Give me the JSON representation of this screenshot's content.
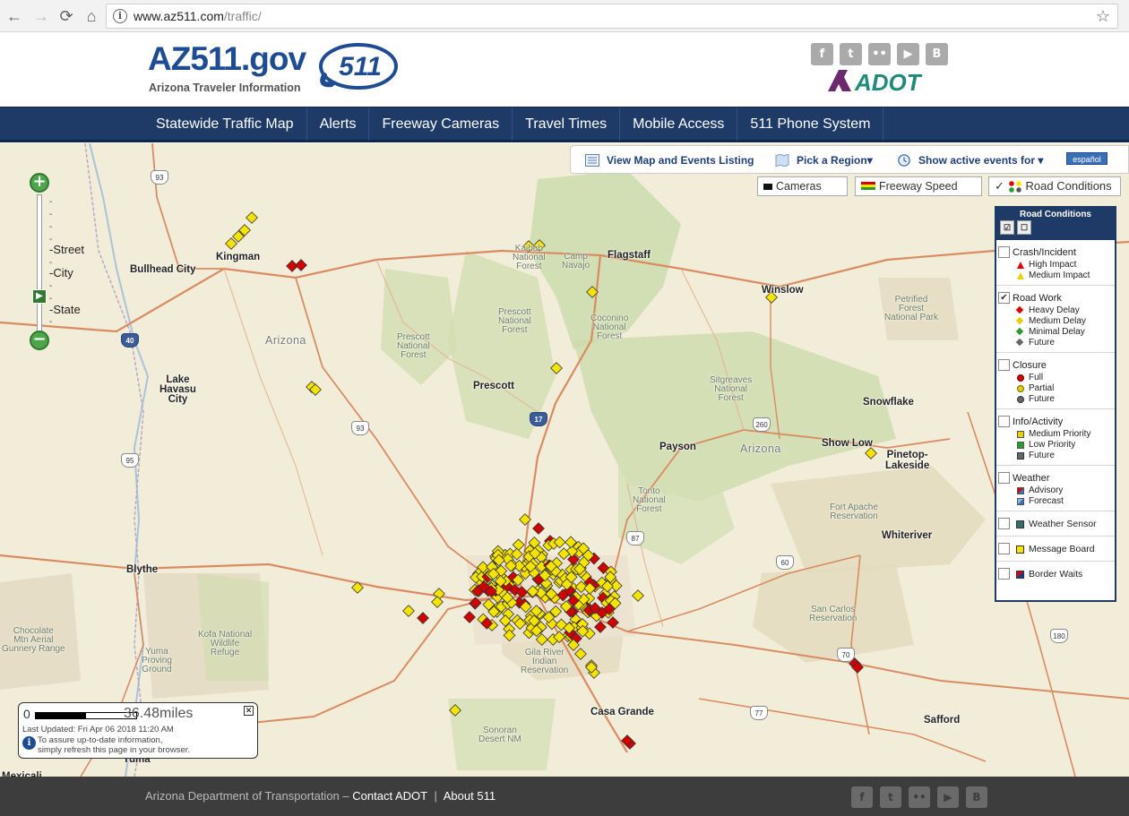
{
  "browser": {
    "url_host": "www.az511.com",
    "url_path": "/traffic/"
  },
  "header": {
    "logo_title": "AZ511.gov",
    "logo_badge": "511",
    "logo_subtitle": "Arizona Traveler Information",
    "agency_logo": "ADOT",
    "social_icons": [
      "facebook-icon",
      "twitter-icon",
      "flickr-icon",
      "youtube-icon",
      "blogger-icon"
    ]
  },
  "nav": {
    "items": [
      "Statewide Traffic Map",
      "Alerts",
      "Freeway Cameras",
      "Travel Times",
      "Mobile Access",
      "511 Phone System"
    ]
  },
  "toolbar": {
    "view_listing": "View Map and Events Listing",
    "pick_region": "Pick a Region▾",
    "show_events": "Show active events for ▾",
    "espanol": "español"
  },
  "layers": {
    "cameras": "Cameras",
    "freeway_speed": "Freeway Speed",
    "road_conditions": "Road Conditions",
    "road_conditions_check": "✓"
  },
  "zoom": {
    "plus": "+",
    "minus": "−",
    "street": "-Street",
    "city": "-City",
    "state": "-State"
  },
  "panel": {
    "title": "Road Conditions",
    "groups": [
      {
        "label": "Crash/Incident",
        "checked": false,
        "items": [
          "High Impact",
          "Medium Impact"
        ]
      },
      {
        "label": "Road Work",
        "checked": true,
        "items": [
          "Heavy Delay",
          "Medium Delay",
          "Minimal Delay",
          "Future"
        ]
      },
      {
        "label": "Closure",
        "checked": false,
        "items": [
          "Full",
          "Partial",
          "Future"
        ]
      },
      {
        "label": "Info/Activity",
        "checked": false,
        "items": [
          "Medium Priority",
          "Low Priority",
          "Future"
        ]
      },
      {
        "label": "Weather",
        "checked": false,
        "items": [
          "Advisory",
          "Forecast"
        ]
      }
    ],
    "singles": [
      "Weather Sensor",
      "Message Board",
      "Border Waits"
    ],
    "check_mark": "✔"
  },
  "map": {
    "cities": {
      "bullhead": "Bullhead City",
      "kingman": "Kingman",
      "flagstaff": "Flagstaff",
      "winslow": "Winslow",
      "prescott": "Prescott",
      "payson": "Payson",
      "snowflake": "Snowflake",
      "show_low": "Show Low",
      "pinetop": "Pinetop-\nLakeside",
      "lake_havasu": "Lake\nHavasu\nCity",
      "blythe": "Blythe",
      "whiteriver": "Whiteriver",
      "casa_grande": "Casa Grande",
      "safford": "Safford",
      "yuma": "Yuma",
      "mexicali": "Mexicali"
    },
    "regions": {
      "arizona_west": "Arizona",
      "arizona_east": "Arizona"
    },
    "parks": {
      "kaibab": "Kaibab\nNational\nForest",
      "camp_navajo": "Camp\nNavajo",
      "prescott_nf1": "Prescott\nNational\nForest",
      "prescott_nf2": "Prescott\nNational\nForest",
      "coconino": "Coconino\nNational\nForest",
      "petrified": "Petrified\nForest\nNational Park",
      "sitgreaves": "Sitgreaves\nNational\nForest",
      "tonto": "Tonto\nNational\nForest",
      "fort_apache": "Fort Apache\nReservation",
      "san_carlos": "San Carlos\nReservation",
      "gila_river": "Gila River\nIndian\nReservation",
      "kofa": "Kofa National\nWildlife\nRefuge",
      "chocolate": "Chocolate\nMtn Aerial\nGunnery Range",
      "yuma_pg": "Yuma\nProving\nGround",
      "sonoran": "Sonoran\nDesert NM"
    },
    "highways": [
      "93",
      "40",
      "93",
      "95",
      "17",
      "260",
      "87",
      "60",
      "70",
      "77",
      "180"
    ]
  },
  "scale": {
    "zero": "0",
    "distance": "36.48miles",
    "last_updated": "Last Updated: Fri Apr 06 2018 11:20 AM",
    "message": "To assure up-to-date information,\nsimply refresh this page in your browser.",
    "close": "✕",
    "info": "i"
  },
  "footer": {
    "agency": "Arizona Department of Transportation –",
    "contact": "Contact ADOT",
    "separator": "|",
    "about": "About 511"
  },
  "colors": {
    "nav_bg": "#1e3a66",
    "logo_blue": "#1e4c93",
    "map_bg": "#f2edd9",
    "forest": "#c8d8a4",
    "reservation": "#e6dcc0",
    "road": "#d98b62",
    "event_yellow": "#f5e400",
    "event_red": "#d00000",
    "footer_bg": "#3d3d3d"
  }
}
